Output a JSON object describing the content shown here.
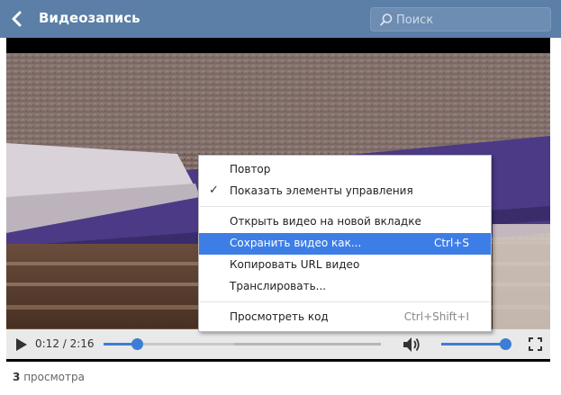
{
  "header": {
    "title": "Видеозапись",
    "search_placeholder": "Поиск",
    "icons": {
      "back": "chevron-left-icon",
      "search": "search-icon"
    },
    "colors": {
      "bar": "#5b7fa6"
    }
  },
  "player": {
    "time": "0:12 / 2:16",
    "progress": 0.12,
    "buffered": 0.47,
    "volume": 0.98,
    "icons": {
      "play": "play-icon",
      "volume": "volume-icon",
      "fullscreen": "fullscreen-icon"
    },
    "colors": {
      "accent": "#3d7dd5"
    }
  },
  "context_menu": {
    "items": [
      {
        "label": "Повтор",
        "shortcut": "",
        "checked": false
      },
      {
        "label": "Показать элементы управления",
        "shortcut": "",
        "checked": true
      },
      {
        "label": "Открыть видео на новой вкладке",
        "shortcut": "",
        "checked": false
      },
      {
        "label": "Сохранить видео как...",
        "shortcut": "Ctrl+S",
        "checked": false,
        "highlighted": true
      },
      {
        "label": "Копировать URL видео",
        "shortcut": "",
        "checked": false
      },
      {
        "label": "Транслировать...",
        "shortcut": "",
        "checked": false
      },
      {
        "label": "Просмотреть код",
        "shortcut": "Ctrl+Shift+I",
        "checked": false
      }
    ],
    "colors": {
      "highlight": "#3d7ee6"
    }
  },
  "footer": {
    "views_count": "3",
    "views_label": "просмотра"
  }
}
